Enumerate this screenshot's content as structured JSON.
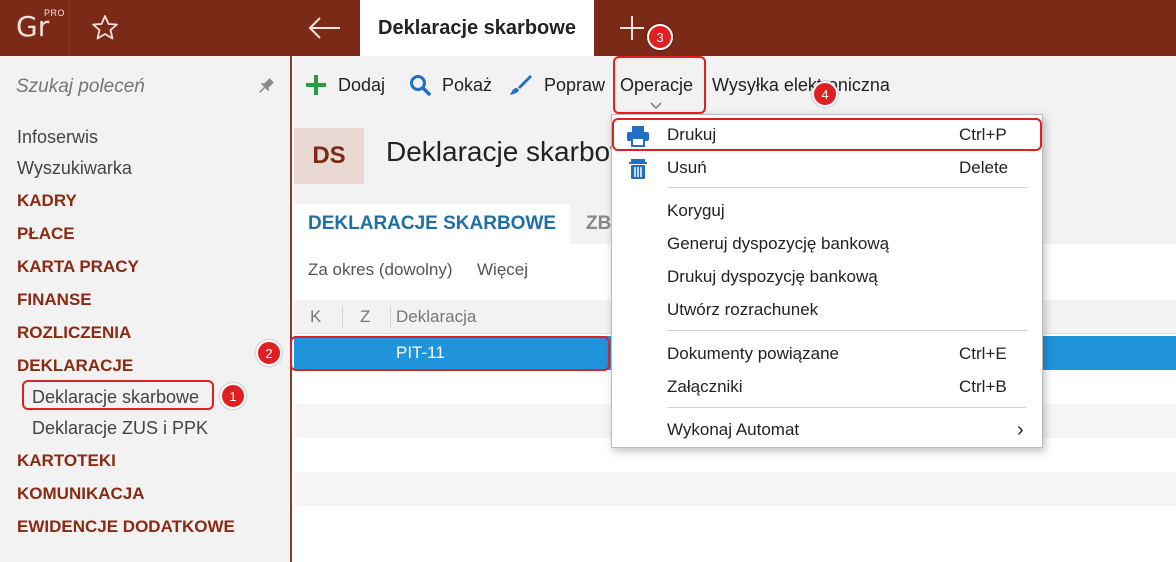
{
  "app": {
    "logo": "Gr",
    "logo_edition": "PRO"
  },
  "topbar": {
    "active_tab": "Deklaracje skarbowe"
  },
  "sidebar": {
    "search_placeholder": "Szukaj poleceń",
    "items": [
      {
        "label": "Infoserwis",
        "kind": "plain"
      },
      {
        "label": "Wyszukiwarka",
        "kind": "plain"
      },
      {
        "label": "KADRY",
        "kind": "section"
      },
      {
        "label": "PŁACE",
        "kind": "section"
      },
      {
        "label": "KARTA PRACY",
        "kind": "section"
      },
      {
        "label": "FINANSE",
        "kind": "section"
      },
      {
        "label": "ROZLICZENIA",
        "kind": "section"
      },
      {
        "label": "DEKLARACJE",
        "kind": "section"
      },
      {
        "label": "Deklaracje skarbowe",
        "kind": "sub"
      },
      {
        "label": "Deklaracje ZUS i PPK",
        "kind": "sub"
      },
      {
        "label": "KARTOTEKI",
        "kind": "section"
      },
      {
        "label": "KOMUNIKACJA",
        "kind": "section"
      },
      {
        "label": "EWIDENCJE DODATKOWE",
        "kind": "section"
      }
    ]
  },
  "toolbar": {
    "add": "Dodaj",
    "show": "Pokaż",
    "edit": "Popraw",
    "operations": "Operacje",
    "eshipping": "Wysyłka elektroniczna"
  },
  "header": {
    "badge": "DS",
    "title": "Deklaracje skarbowe"
  },
  "tabs": {
    "tab1": "DEKLARACJE SKARBOWE",
    "tab2": "ZBIORCZE"
  },
  "filters": {
    "period": "Za okres (dowolny)",
    "more": "Więcej"
  },
  "grid": {
    "columns": [
      "K",
      "Z",
      "Deklaracja"
    ],
    "rows": [
      {
        "deklaracja": "PIT-11"
      }
    ]
  },
  "menu": {
    "print": {
      "label": "Drukuj",
      "shortcut": "Ctrl+P"
    },
    "delete": {
      "label": "Usuń",
      "shortcut": "Delete"
    },
    "correct": {
      "label": "Koryguj"
    },
    "gen_bank": {
      "label": "Generuj dyspozycję bankową"
    },
    "print_bank": {
      "label": "Drukuj dyspozycję bankową"
    },
    "create_settlement": {
      "label": "Utwórz rozrachunek"
    },
    "related_docs": {
      "label": "Dokumenty powiązane",
      "shortcut": "Ctrl+E"
    },
    "attachments": {
      "label": "Załączniki",
      "shortcut": "Ctrl+B"
    },
    "run_automat": {
      "label": "Wykonaj Automat",
      "arrow": "›"
    }
  },
  "annotations": {
    "b1": "1",
    "b2": "2",
    "b3": "3",
    "b4": "4"
  },
  "colors": {
    "brand": "#7a2a17",
    "accent_blue": "#1f94db",
    "highlight": "#e02020",
    "section": "#8b2a13"
  }
}
